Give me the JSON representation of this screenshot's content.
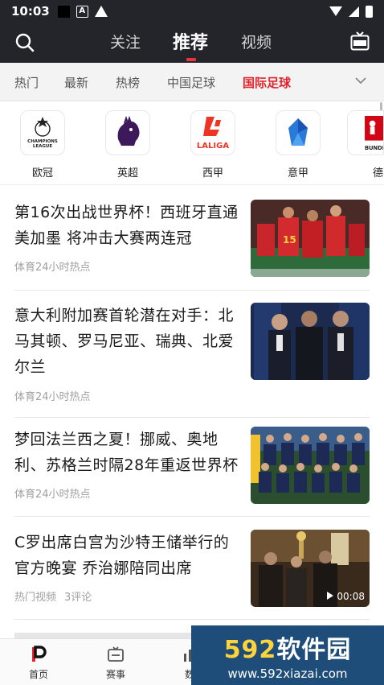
{
  "status_bar": {
    "time": "10:03",
    "a_glyph": "A"
  },
  "header": {
    "tabs": [
      "关注",
      "推荐",
      "视频"
    ],
    "active_tab": "推荐"
  },
  "categories": {
    "items": [
      "热门",
      "最新",
      "热榜",
      "中国足球",
      "国际足球"
    ],
    "active": "国际足球"
  },
  "leagues": [
    {
      "name": "欧冠",
      "logo_text": "CHAMPIONS LEAGUE"
    },
    {
      "name": "英超",
      "logo_text": ""
    },
    {
      "name": "西甲",
      "logo_text": "LALIGA"
    },
    {
      "name": "意甲",
      "logo_text": ""
    },
    {
      "name": "德",
      "logo_text": "BUNDE"
    }
  ],
  "news": [
    {
      "title": "第16次出战世界杯！西班牙直通美加墨 将冲击大赛两连冠",
      "source": "体育24小时热点",
      "comments": ""
    },
    {
      "title": "意大利附加赛首轮潜在对手：北马其顿、罗马尼亚、瑞典、北爱尔兰",
      "source": "体育24小时热点",
      "comments": ""
    },
    {
      "title": "梦回法兰西之夏！挪威、奥地利、苏格兰时隔28年重返世界杯",
      "source": "体育24小时热点",
      "comments": ""
    },
    {
      "title": "C罗出席白宫为沙特王储举行的官方晚宴 乔治娜陪同出席",
      "source": "热门视频",
      "comments": "3评论",
      "duration": "00:08"
    }
  ],
  "bottom_nav": [
    "首页",
    "赛事",
    "数"
  ],
  "watermark": {
    "number": "592",
    "text": "软件园",
    "url": "www.592xiazai.com"
  },
  "colors": {
    "accent": "#e5252e",
    "header_bg": "#24252a"
  }
}
